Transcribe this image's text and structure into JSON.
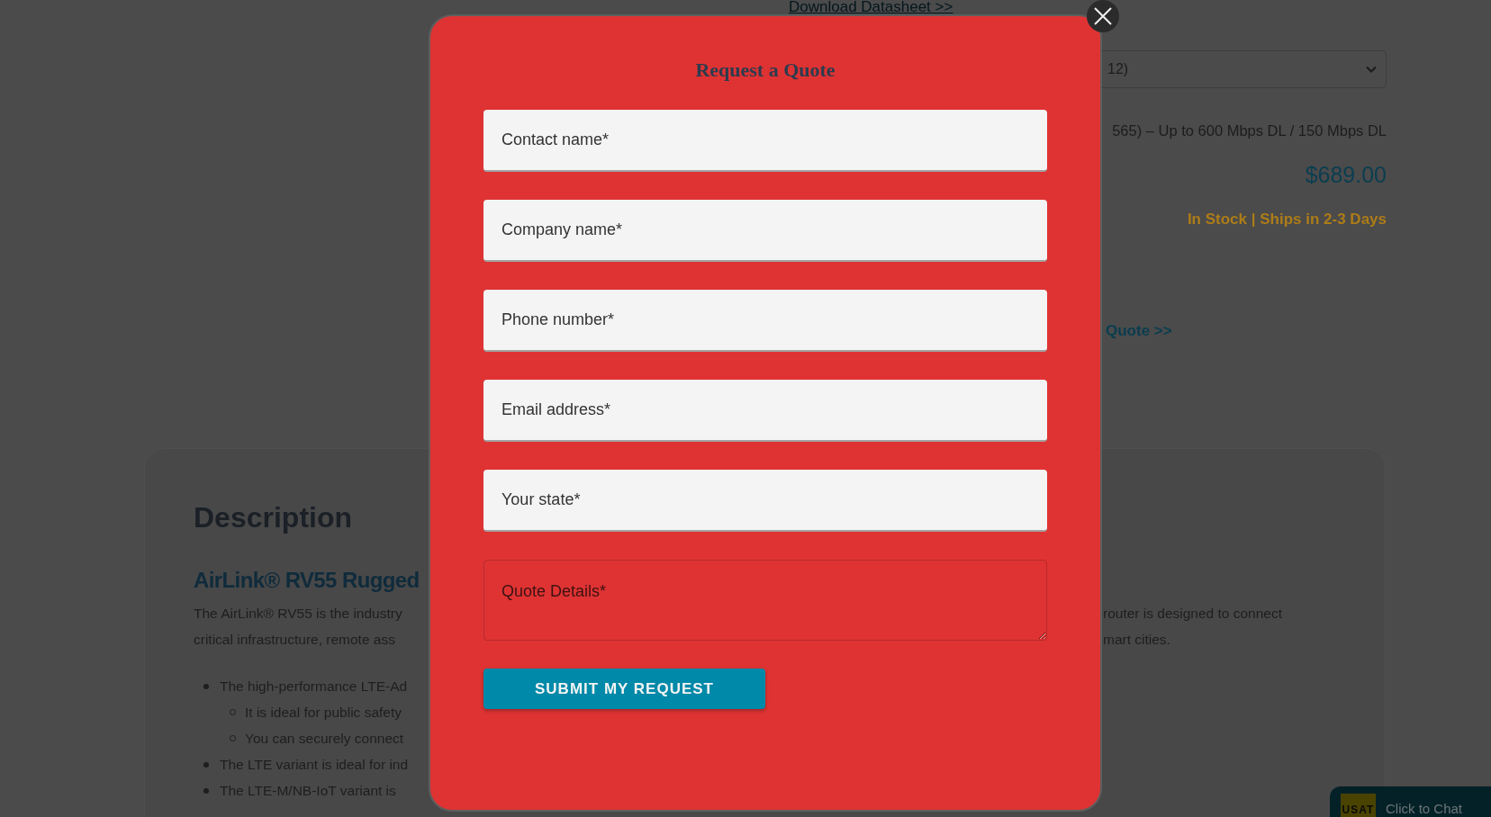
{
  "product": {
    "datasheet_link": "Download Datasheet >>",
    "variant_select": {
      "value": "12)"
    },
    "spec": "565) – Up to 600 Mbps DL / 150 Mbps DL",
    "price": "$689.00",
    "stock": "In Stock | Ships in 2-3 Days",
    "quote_link": "Quote >>"
  },
  "description": {
    "heading": "Description",
    "subheading": "AirLink® RV55 Rugged",
    "paragraph_lines": [
      {
        "left_part": "The AirLink® RV55 is the industry",
        "right_part": "router is designed to connect"
      },
      {
        "left_part": "critical infrastructure, remote ass",
        "right_part": "mart cities."
      }
    ],
    "bullets": [
      {
        "text": "The high-performance LTE-Ad",
        "children": [
          {
            "text": "It is ideal for public safety"
          },
          {
            "text": "You can securely connect"
          }
        ]
      },
      {
        "text": "The LTE variant is ideal for ind"
      },
      {
        "text": "The LTE-M/NB-IoT variant is"
      }
    ]
  },
  "modal": {
    "title": "Request a Quote",
    "fields": [
      {
        "kind": "input",
        "placeholder": "Contact name*"
      },
      {
        "kind": "input",
        "placeholder": "Company name*"
      },
      {
        "kind": "input",
        "placeholder": "Phone number*"
      },
      {
        "kind": "input",
        "placeholder": "Email address*"
      },
      {
        "kind": "input",
        "placeholder": "Your state*"
      },
      {
        "kind": "textarea",
        "placeholder": "Quote Details*"
      }
    ],
    "submit_button": "SUBMIT MY REQUEST"
  },
  "chat_widget": {
    "logo": "USAT",
    "label": "Click to Chat"
  }
}
